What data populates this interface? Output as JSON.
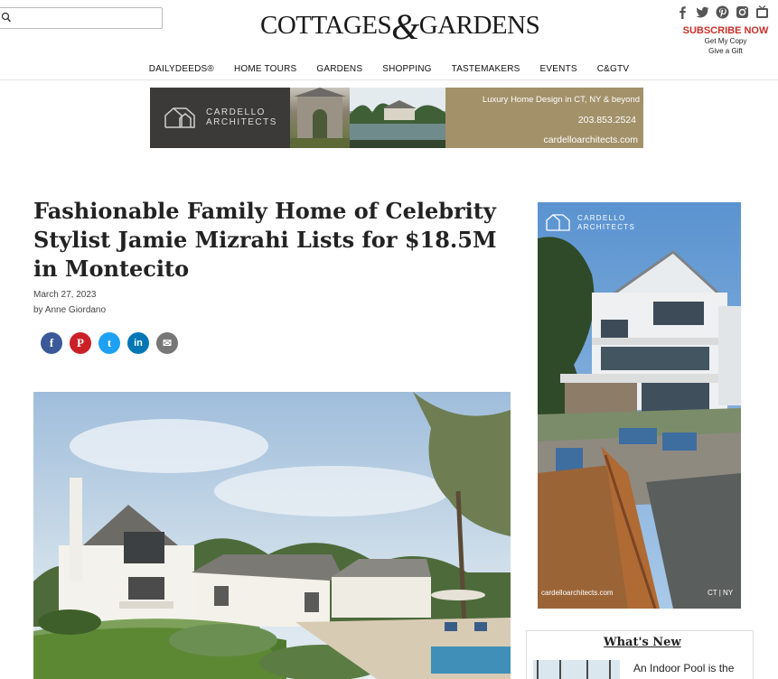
{
  "search": {
    "placeholder": "",
    "value": ""
  },
  "logo": {
    "left": "COTTAGES",
    "amp": "&",
    "right": "GARDENS"
  },
  "social": {
    "icons": [
      "facebook-icon",
      "twitter-icon",
      "pinterest-icon",
      "instagram-icon",
      "tv-icon"
    ]
  },
  "subscribe": {
    "title": "SUBSCRIBE NOW",
    "get_copy": "Get My Copy",
    "gift": "Give a Gift"
  },
  "nav": {
    "items": [
      "DAILYDEEDS®",
      "HOME TOURS",
      "GARDENS",
      "SHOPPING",
      "TASTEMAKERS",
      "EVENTS",
      "C&GTV"
    ]
  },
  "banner_ad": {
    "firm_line1": "CARDELLO",
    "firm_line2": "ARCHITECTS",
    "tagline": "Luxury Home Design in CT, NY & beyond",
    "phone": "203.853.2524",
    "url": "cardelloarchitects.com"
  },
  "article": {
    "headline": "Fashionable Family Home of Celebrity Stylist Jamie Mizrahi Lists for $18.5M in Montecito",
    "date": "March 27, 2023",
    "byline": "by Anne Giordano"
  },
  "share": {
    "facebook": "f",
    "pinterest": "P",
    "twitter": "t",
    "linkedin": "in",
    "email": "✉"
  },
  "side_ad": {
    "firm_line1": "CARDELLO",
    "firm_line2": "ARCHITECTS",
    "url": "cardelloarchitects.com",
    "location": "CT | NY"
  },
  "whats_new": {
    "heading": "What's New",
    "first_item": "An Indoor Pool is the"
  },
  "colors": {
    "subscribe_red": "#c8302a",
    "facebook": "#3b5998",
    "pinterest": "#cb2027",
    "twitter": "#1da1f2",
    "linkedin": "#0077b5",
    "email": "#777777",
    "ad_gold": "#a3916a",
    "ad_dark": "#3b3a38"
  }
}
